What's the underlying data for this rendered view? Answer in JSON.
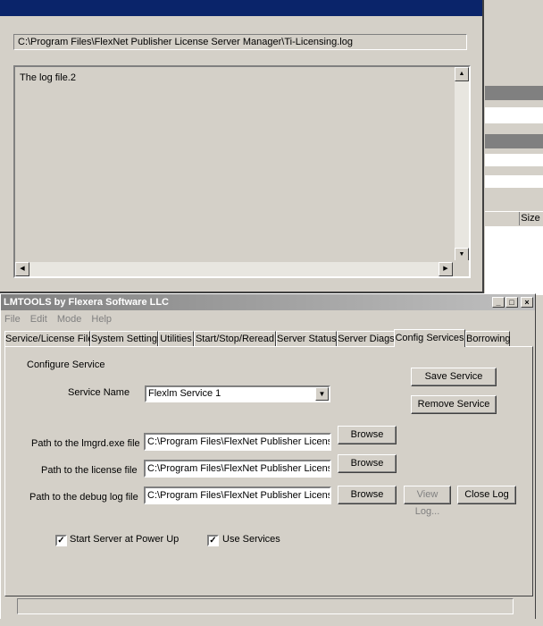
{
  "log_window": {
    "path": "C:\\Program Files\\FlexNet Publisher License Server Manager\\Ti-Licensing.log",
    "content": "The log file.2"
  },
  "background_window": {
    "column_size": "Size"
  },
  "lmtools": {
    "title": "LMTOOLS by Flexera Software LLC",
    "window_buttons": {
      "minimize": "_",
      "maximize": "□",
      "close": "×"
    },
    "menu": [
      "File",
      "Edit",
      "Mode",
      "Help"
    ],
    "tabs": [
      "Service/License File",
      "System Settings",
      "Utilities",
      "Start/Stop/Reread",
      "Server Status",
      "Server Diags",
      "Config Services",
      "Borrowing"
    ],
    "active_tab": "Config Services",
    "config": {
      "section_label": "Configure Service",
      "service_name_label": "Service Name",
      "service_name_value": "Flexlm Service 1",
      "lmgrd_label": "Path to the lmgrd.exe file",
      "lmgrd_value": "C:\\Program Files\\FlexNet Publisher License Ser",
      "license_label": "Path to the license file",
      "license_value": "C:\\Program Files\\FlexNet Publisher License Ser",
      "debug_label": "Path to the debug log file",
      "debug_value": "C:\\Program Files\\FlexNet Publisher License Ser",
      "save_service": "Save Service",
      "remove_service": "Remove Service",
      "browse": "Browse",
      "view_log": "View Log...",
      "close_log": "Close Log",
      "start_at_powerup_label": "Start Server at Power Up",
      "start_at_powerup_checked": true,
      "use_services_label": "Use Services",
      "use_services_checked": true
    }
  }
}
